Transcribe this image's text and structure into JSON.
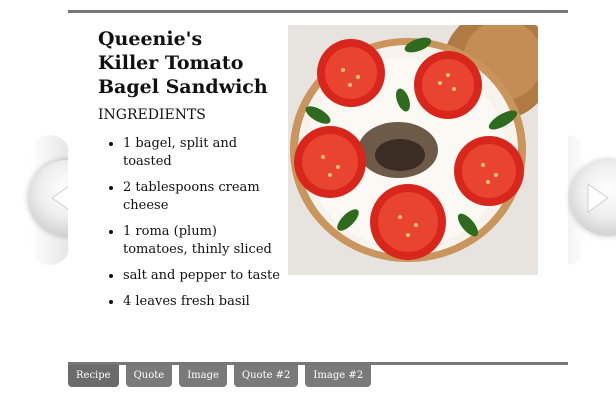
{
  "recipe": {
    "title": "Queenie's Killer Tomato Bagel Sandwich",
    "ingredients_heading": "INGREDIENTS",
    "ingredients": [
      "1 bagel, split and toasted",
      "2 tablespoons cream cheese",
      "1 roma (plum) tomatoes, thinly sliced",
      "salt and pepper to taste",
      "4 leaves fresh basil"
    ]
  },
  "photo": {
    "icon": "bagel-photo"
  },
  "navigation": {
    "prev_icon": "chevron-left-icon",
    "next_icon": "chevron-right-icon"
  },
  "tabs": [
    {
      "label": "Recipe"
    },
    {
      "label": "Quote"
    },
    {
      "label": "Image"
    },
    {
      "label": "Quote #2"
    },
    {
      "label": "Image #2"
    }
  ],
  "colors": {
    "rule": "#777777",
    "tab_bg": "#7a7a7a",
    "tab_text": "#ffffff",
    "tomato": "#d9261c",
    "basil": "#2f6b1f"
  }
}
